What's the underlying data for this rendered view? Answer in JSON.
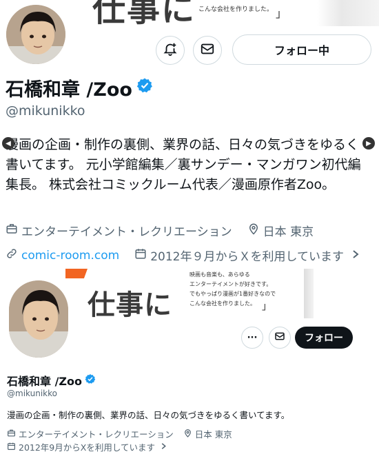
{
  "profile_zoom": {
    "banner": {
      "big_text": "仕事に",
      "small_text": "こんな会社を作りました。",
      "bracket": "」"
    },
    "follow_button_label": "フォロー中",
    "display_name": "石橋和章 /Zoo",
    "handle": "@mikunikko",
    "bio": "漫画の企画・制作の裏側、業界の話、日々の気づきをゆるく書いてます。 元小学館編集／裏サンデー・マンガワン初代編集長。 株式会社コミックルーム代表／漫画原作者Zoo。",
    "category": "エンターテイメント・レクリエーション",
    "location": "日本 東京",
    "website": "comic-room.com",
    "joined": "2012年９月からＸを利用しています"
  },
  "profile_standard": {
    "banner": {
      "big_text": "仕事に",
      "lines": [
        "映画も音楽も、あらゆる",
        "エンターテイメントが好きです。",
        "でもやっぱり漫画が1番好きなので",
        "こんな会社を作りました。"
      ],
      "bracket": "」"
    },
    "more_label": "···",
    "follow_button_label": "フォロー",
    "display_name": "石橋和章 /Zoo",
    "handle": "@mikunikko",
    "bio": "漫画の企画・制作の裏側、業界の話、日々の気づきをゆるく書いてます。",
    "category": "エンターテイメント・レクリエーション",
    "location": "日本 東京",
    "joined": "2012年9月からXを利用しています"
  },
  "colors": {
    "verified": "#1d9bf0",
    "link": "#1d9bf0",
    "text_secondary": "#536471",
    "button_dark": "#0f1419",
    "banner_accent": "#f26522"
  },
  "icons": [
    "notification-bell-plus-icon",
    "mail-icon",
    "verified-badge-icon",
    "briefcase-icon",
    "location-pin-icon",
    "link-icon",
    "calendar-icon",
    "chevron-right-icon",
    "arrow-left-icon",
    "arrow-right-icon"
  ]
}
